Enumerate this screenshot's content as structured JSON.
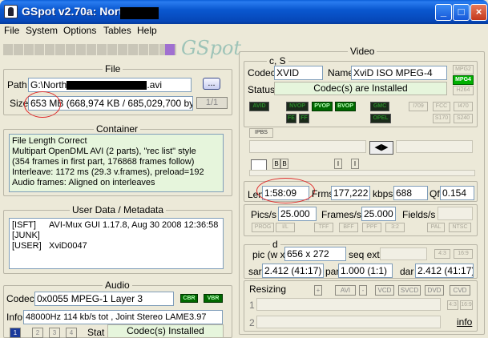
{
  "window": {
    "title": "GSpot v2.70a: North"
  },
  "menu": [
    "File",
    "System",
    "Options",
    "Tables",
    "Help"
  ],
  "logo": "GSpot",
  "file": {
    "caption": "File",
    "path_label": "Path",
    "path_prefix": "G:\\North",
    "path_suffix": ".avi",
    "browse_label": "...",
    "size_label": "Size",
    "size_value": "653 MB",
    "size_detail": "(668,974 KB / 685,029,700 bytes)",
    "page_indicator": "1/1"
  },
  "container": {
    "caption": "Container",
    "lines": [
      "File Length Correct",
      "Multipart OpenDML AVI (2 parts), \"rec list\" style",
      "(354 frames in first part, 176868 frames follow)",
      "Interleave: 1172 ms (29.3 v.frames), preload=192",
      "Audio frames: Aligned on interleaves"
    ]
  },
  "user_data": {
    "caption": "User Data / Metadata",
    "rows": [
      {
        "tag": "[ISFT]",
        "value": "AVI-Mux GUI 1.17.8, Aug 30 2008  12:36:58"
      },
      {
        "tag": "[JUNK]",
        "value": ""
      },
      {
        "tag": "[USER]",
        "value": "XviD0047"
      }
    ]
  },
  "audio": {
    "caption": "Audio",
    "codec_label": "Codec",
    "codec_value": "0x0055  MPEG-1 Layer 3",
    "cbr": "CBR",
    "vbr": "VBR",
    "info_label": "Info",
    "info_value": "48000Hz  114 kb/s tot , Joint Stereo LAME3.97",
    "streams": [
      "1",
      "2",
      "3",
      "4"
    ],
    "stat_label": "Stat",
    "stat_value": "Codec(s) Installed"
  },
  "video": {
    "caption": "Video",
    "cs_caption": "c, S",
    "codec_label": "Codec",
    "codec_value": "XVID",
    "name_label": "Name",
    "name_value": "XviD ISO MPEG-4",
    "status_label": "Status",
    "status_value": "Codec(s) are Installed",
    "side_tags": [
      "MPG2",
      "MPG4",
      "H264"
    ],
    "qpel_gmc": [
      "QPEL",
      "GMC"
    ],
    "flags_row1": [
      "AVID",
      "NVOP",
      "PVOP",
      "BVOP",
      "GMC",
      "I709",
      "FCC",
      "I470"
    ],
    "flags_row2": [
      "FE",
      "FF",
      "OPEL",
      "S170",
      "S240"
    ],
    "ipb_tag": "IPBS",
    "frame_labels": [
      "B",
      "B",
      "I",
      "I"
    ],
    "len_label": "Len",
    "len_value": "1:58:09",
    "frms_label": "Frms",
    "frms_value": "177,222",
    "kbps_label": "kbps",
    "kbps_value": "688",
    "qf_label": "Qf",
    "qf_value": "0.154",
    "pics_label": "Pics/s",
    "pics_value": "25.000",
    "frames_label": "Frames/s",
    "frames_value": "25.000",
    "fields_label": "Fields/s",
    "pulldown_tags": [
      "PROG",
      "I/L",
      "TFF",
      "BFF",
      "PPF",
      "3:2",
      "PAL",
      "NTSC"
    ],
    "d_caption": "d",
    "pic_label": "pic (w x h)",
    "pic_value": "656 x 272",
    "seqext_label": "seq ext",
    "aspect_tags": [
      "4:3",
      "16:9"
    ],
    "sar_label": "sar",
    "sar_value": "2.412 (41:17)",
    "par_label": "par",
    "par_value": "1.000 (1:1)",
    "dar_label": "dar",
    "dar_value": "2.412 (41:17)",
    "resizing_label": "Resizing",
    "resize_buttons": [
      "AVI",
      "VCD",
      "SVCD",
      "DVD",
      "CVD"
    ],
    "resize_rows": [
      "1",
      "2"
    ],
    "resize_aspects": [
      "4:3",
      "16:9"
    ],
    "info_link": "info"
  },
  "colors": {
    "title_bar": "#0a58d0",
    "status_green": "#e6f5dc",
    "flag_on": "#00d000",
    "annotation": "#e03030"
  }
}
